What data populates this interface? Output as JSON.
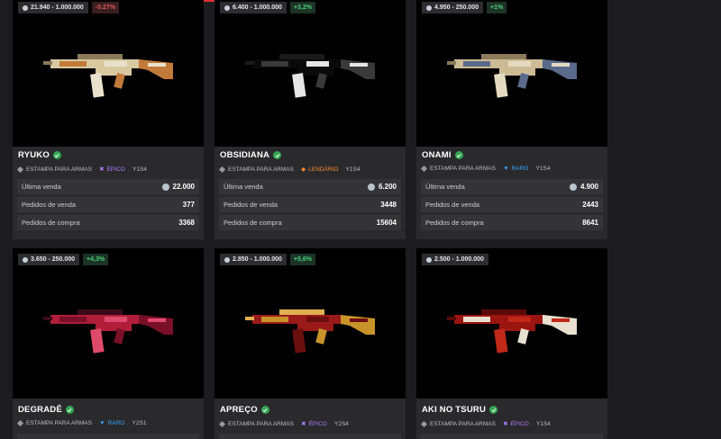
{
  "cards": [
    {
      "price_range": "21.940 - 1.000.000",
      "change": "-0.27%",
      "change_type": "neg",
      "name": "RYUKO",
      "type": "ESTAMPA PARA ARMAS",
      "rarity": "ÉPICO",
      "rarity_class": "epic",
      "season": "Y1S4",
      "rows": [
        {
          "label": "Última venda",
          "value": "22.000",
          "coin": true
        },
        {
          "label": "Pedidos de venda",
          "value": "377"
        },
        {
          "label": "Pedidos de compra",
          "value": "3368"
        }
      ],
      "skin_colors": [
        "#d8c9a0",
        "#c27a3a",
        "#e9e1cc",
        "#8a7a5a"
      ]
    },
    {
      "price_range": "6.400 - 1.000.000",
      "change": "+3,2%",
      "change_type": "pos",
      "name": "OBSIDIANA",
      "type": "ESTAMPA PARA ARMAS",
      "rarity": "LENDÁRIO",
      "rarity_class": "leg",
      "season": "Y1S4",
      "rows": [
        {
          "label": "Última venda",
          "value": "6.200",
          "coin": true
        },
        {
          "label": "Pedidos de venda",
          "value": "3448"
        },
        {
          "label": "Pedidos de compra",
          "value": "15604"
        }
      ],
      "skin_colors": [
        "#0a0a0a",
        "#3a3a3a",
        "#e6e6e6",
        "#1a1a1a"
      ]
    },
    {
      "price_range": "4.950 - 250.000",
      "change": "+1%",
      "change_type": "pos",
      "name": "ONAMI",
      "type": "ESTAMPA PARA ARMAS",
      "rarity": "RARO",
      "rarity_class": "raro",
      "season": "Y1S4",
      "rows": [
        {
          "label": "Última venda",
          "value": "4.900",
          "coin": true
        },
        {
          "label": "Pedidos de venda",
          "value": "2443"
        },
        {
          "label": "Pedidos de compra",
          "value": "8641"
        }
      ],
      "skin_colors": [
        "#cdbb95",
        "#5a6a8a",
        "#e4dac2",
        "#8c7c5c"
      ]
    },
    {
      "price_range": "3.650 - 250.000",
      "change": "+4,3%",
      "change_type": "pos",
      "name": "DEGRADÊ",
      "type": "ESTAMPA PARA ARMAS",
      "rarity": "RARO",
      "rarity_class": "raro",
      "season": "Y2S1",
      "rows": [],
      "skin_colors": [
        "#b01e3a",
        "#7a0f2a",
        "#e04a6a",
        "#3a0a18"
      ]
    },
    {
      "price_range": "2.850 - 1.000.000",
      "change": "+5,6%",
      "change_type": "pos",
      "name": "APREÇO",
      "type": "ESTAMPA PARA ARMAS",
      "rarity": "ÉPICO",
      "rarity_class": "epic",
      "season": "Y2S4",
      "rows": [],
      "skin_colors": [
        "#9a1a1a",
        "#c8942a",
        "#6a0e0e",
        "#e0b050"
      ]
    },
    {
      "price_range": "2.500 - 1.000.000",
      "change": "",
      "change_type": "",
      "name": "AKI NO TSURU",
      "type": "ESTAMPA PARA ARMAS",
      "rarity": "ÉPICO",
      "rarity_class": "epic",
      "season": "Y1S4",
      "rows": [],
      "skin_colors": [
        "#9a1410",
        "#e8e0d0",
        "#c02818",
        "#5a0a08"
      ]
    }
  ]
}
